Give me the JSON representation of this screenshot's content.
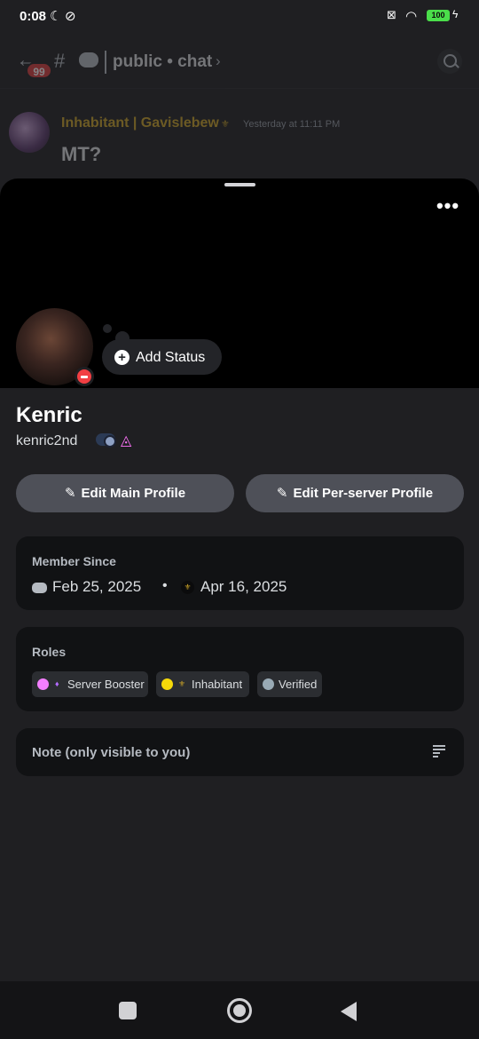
{
  "status_bar": {
    "time": "0:08",
    "battery": "100"
  },
  "channel_header": {
    "unread_badge": "99",
    "title": "public • chat"
  },
  "message": {
    "author": "Inhabitant | Gavislebew",
    "guild_tag": "⚜",
    "timestamp": "Yesterday at 11:11 PM",
    "content": "MT?"
  },
  "profile": {
    "more_label": "•••",
    "add_status_label": "Add Status",
    "display_name": "Kenric",
    "username": "kenric2nd",
    "edit_main_label": "Edit Main Profile",
    "edit_server_label": "Edit Per-server Profile"
  },
  "member_since": {
    "heading": "Member Since",
    "discord_date": "Feb 25, 2025",
    "separator": "•",
    "server_date": "Apr 16, 2025"
  },
  "roles": {
    "heading": "Roles",
    "items": [
      {
        "label": "Server Booster",
        "color": "#f47fff"
      },
      {
        "label": "Inhabitant",
        "color": "#f5d90a"
      },
      {
        "label": "Verified",
        "color": "#99aab5"
      }
    ]
  },
  "note": {
    "label": "Note (only visible to you)"
  },
  "colors": {
    "accent_status_dnd": "#f23f43",
    "author_gold": "#c9a227"
  }
}
